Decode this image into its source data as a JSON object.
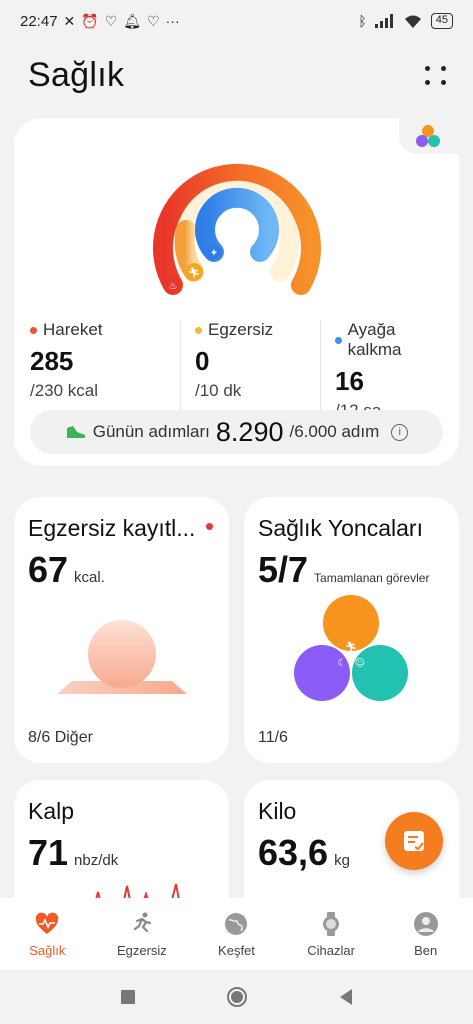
{
  "status_bar": {
    "time": "22:47",
    "battery": "45",
    "more": "···"
  },
  "header": {
    "title": "Sağlık"
  },
  "rings": {
    "metrics": [
      {
        "label": "Hareket",
        "value": "285",
        "target": "/230 kcal",
        "color": "#f0522a"
      },
      {
        "label": "Egzersiz",
        "value": "0",
        "target": "/10 dk",
        "color": "#f6b731"
      },
      {
        "label": "Ayağa kalkma",
        "value": "16",
        "target": "/12 sa",
        "color": "#3d8ff0"
      }
    ],
    "steps_label": "Günün adımları",
    "steps_value": "8.290",
    "steps_goal": "/6.000 adım"
  },
  "cards": {
    "exercise": {
      "title": "Egzersiz kayıtl...",
      "value": "67",
      "unit": "kcal.",
      "footer": "8/6 Diğer"
    },
    "clover": {
      "title": "Sağlık Yoncaları",
      "value": "5/7",
      "unit": "Tamamlanan görevler",
      "footer": "11/6"
    },
    "heart": {
      "title": "Kalp",
      "value": "71",
      "unit": "nbz/dk"
    },
    "weight": {
      "title": "Kilo",
      "value": "63,6",
      "unit": "kg"
    }
  },
  "nav": {
    "items": [
      {
        "label": "Sağlık",
        "icon": "heart-pulse-icon",
        "active": true
      },
      {
        "label": "Egzersiz",
        "icon": "running-icon",
        "active": false
      },
      {
        "label": "Keşfet",
        "icon": "globe-icon",
        "active": false
      },
      {
        "label": "Cihazlar",
        "icon": "watch-icon",
        "active": false
      },
      {
        "label": "Ben",
        "icon": "person-icon",
        "active": false
      }
    ]
  },
  "colors": {
    "accent": "#f05a24",
    "move": "#f0522a",
    "exercise": "#f6b731",
    "stand": "#3d8ff0"
  }
}
